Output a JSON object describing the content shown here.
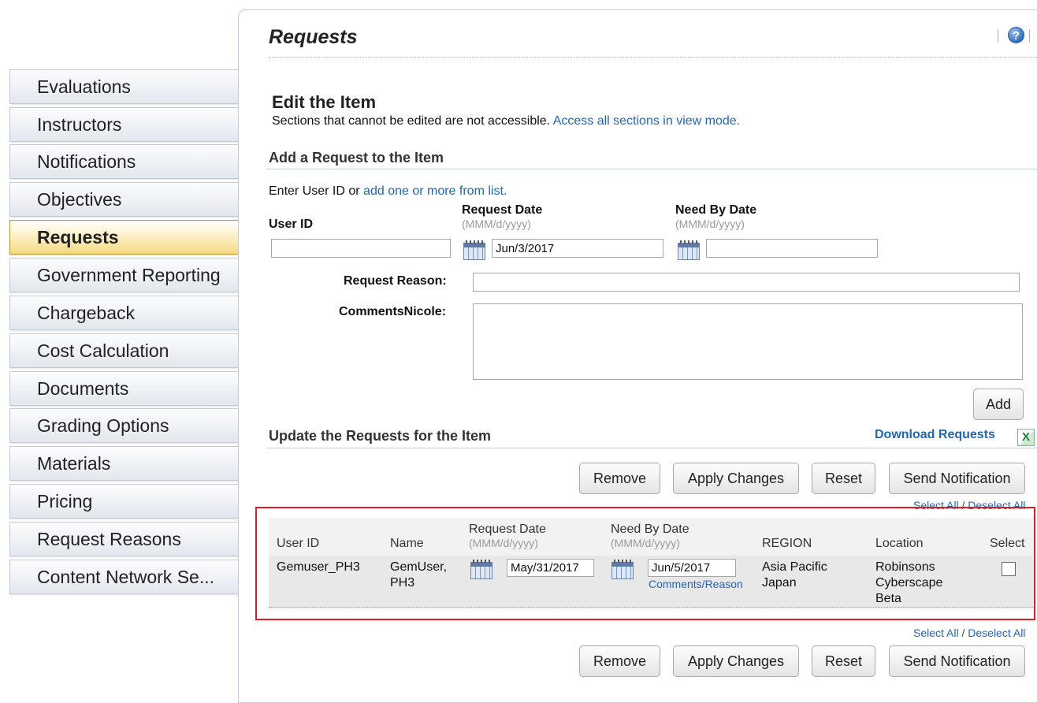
{
  "sidebar": {
    "items": [
      {
        "label": "Evaluations"
      },
      {
        "label": "Instructors"
      },
      {
        "label": "Notifications"
      },
      {
        "label": "Objectives"
      },
      {
        "label": "Requests",
        "active": true
      },
      {
        "label": "Government Reporting"
      },
      {
        "label": "Chargeback"
      },
      {
        "label": "Cost Calculation"
      },
      {
        "label": "Documents"
      },
      {
        "label": "Grading Options"
      },
      {
        "label": "Materials"
      },
      {
        "label": "Pricing"
      },
      {
        "label": "Request Reasons"
      },
      {
        "label": "Content Network Se..."
      }
    ]
  },
  "header": {
    "title": "Requests",
    "help_icon_glyph": "?"
  },
  "edit": {
    "heading": "Edit the Item",
    "note": "Sections that cannot be edited are not accessible.",
    "view_mode_link": "Access all sections in view mode."
  },
  "add_section": {
    "title": "Add a Request to the Item",
    "enter_user_text": "Enter User ID or",
    "add_from_list_link": "add one or more from list.",
    "user_id_label": "User ID",
    "user_id_value": "",
    "request_date_label": "Request Date",
    "request_date_hint": "(MMM/d/yyyy)",
    "request_date_value": "Jun/3/2017",
    "need_by_label": "Need By Date",
    "need_by_hint": "(MMM/d/yyyy)",
    "need_by_value": "",
    "reason_label": "Request Reason:",
    "reason_value": "",
    "comments_label": "CommentsNicole:",
    "comments_value": "",
    "add_button": "Add"
  },
  "update_section": {
    "title": "Update the Requests for the Item",
    "download_link": "Download Requests",
    "excel_icon_glyph": "X",
    "buttons": {
      "remove": "Remove",
      "apply": "Apply Changes",
      "reset": "Reset",
      "notify": "Send Notification"
    },
    "select_all": "Select All",
    "separator": "/",
    "deselect_all": "Deselect All"
  },
  "table": {
    "headers": {
      "user_id": "User ID",
      "name": "Name",
      "request_date": "Request Date",
      "request_date_hint": "(MMM/d/yyyy)",
      "need_by": "Need By Date",
      "need_by_hint": "(MMM/d/yyyy)",
      "region": "REGION",
      "location": "Location",
      "select": "Select"
    },
    "rows": [
      {
        "user_id": "Gemuser_PH3",
        "name_line1": "GemUser,",
        "name_line2": "PH3",
        "request_date": "May/31/2017",
        "need_by": "Jun/5/2017",
        "comments_link": "Comments/Reason",
        "region_line1": "Asia Pacific",
        "region_line2": "Japan",
        "location_line1": "Robinsons",
        "location_line2": "Cyberscape",
        "location_line3": "Beta",
        "selected": false
      }
    ]
  },
  "colors": {
    "link": "#2166b7",
    "active_tab": "#f4d982",
    "highlight_box": "#d91e2a"
  }
}
